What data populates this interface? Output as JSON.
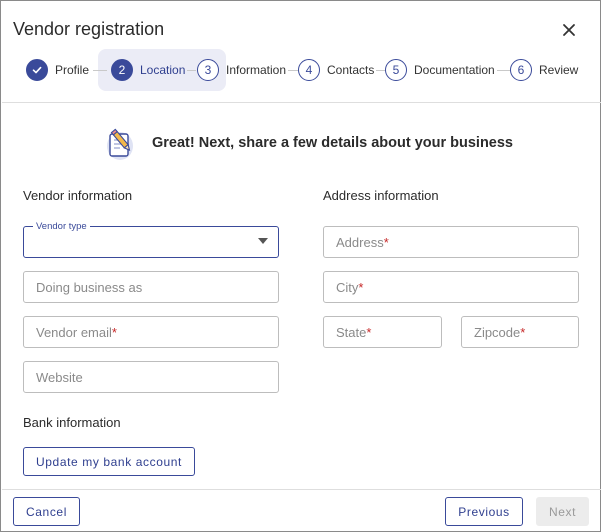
{
  "dialog": {
    "title": "Vendor registration",
    "close_icon": "close-icon"
  },
  "stepper": {
    "steps": [
      {
        "number": "",
        "label": "Profile",
        "state": "completed",
        "icon": "check-icon"
      },
      {
        "number": "2",
        "label": "Location",
        "state": "active"
      },
      {
        "number": "3",
        "label": "Information",
        "state": "upcoming"
      },
      {
        "number": "4",
        "label": "Contacts",
        "state": "upcoming"
      },
      {
        "number": "5",
        "label": "Documentation",
        "state": "upcoming"
      },
      {
        "number": "6",
        "label": "Review",
        "state": "upcoming"
      }
    ]
  },
  "intro": {
    "icon": "pencil-note-icon",
    "text": "Great! Next, share a few details about your business"
  },
  "vendor_section": {
    "title": "Vendor information",
    "vendor_type": {
      "label": "Vendor type",
      "value": ""
    },
    "doing_business_as": {
      "placeholder": "Doing business as"
    },
    "vendor_email": {
      "placeholder": "Vendor email",
      "required_mark": "*"
    },
    "website": {
      "placeholder": "Website"
    }
  },
  "address_section": {
    "title": "Address information",
    "address": {
      "placeholder": "Address",
      "required_mark": "*"
    },
    "city": {
      "placeholder": "City",
      "required_mark": "*"
    },
    "state": {
      "placeholder": "State",
      "required_mark": "*"
    },
    "zipcode": {
      "placeholder": "Zipcode",
      "required_mark": "*"
    }
  },
  "bank_section": {
    "title": "Bank information",
    "button_label": "Update my bank account"
  },
  "footer": {
    "cancel_label": "Cancel",
    "previous_label": "Previous",
    "next_label": "Next"
  },
  "colors": {
    "accent": "#3a4a9a",
    "active_step_bg": "#ebecf6",
    "required": "#c62828",
    "disabled_bg": "#ececec"
  }
}
